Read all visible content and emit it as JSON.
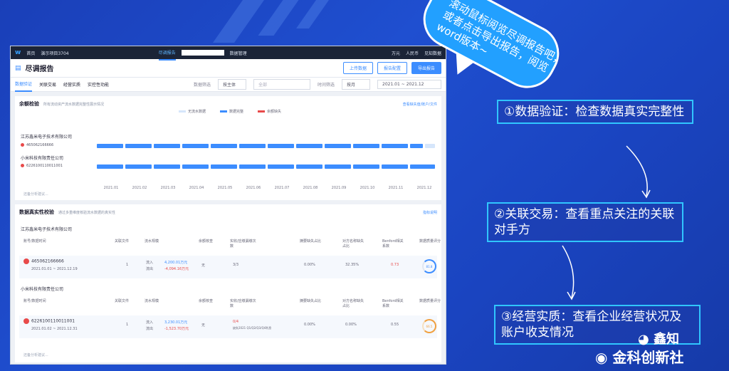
{
  "app": {
    "nav_home": "首页",
    "nav_project": "演示项目3704",
    "tab_report": "尽调报告",
    "tab_data": "数据管理",
    "unit": "万元",
    "currency": "人民币",
    "user": "见知数据"
  },
  "title": {
    "page": "尽调报告",
    "btn_upload": "上传数据",
    "btn_config": "报告配置",
    "btn_export": "导出报告"
  },
  "tabs": [
    "数据验证",
    "关联交易",
    "经营实质",
    "实控性功能"
  ],
  "filters": {
    "filter1_label": "数据筛选",
    "filter1_value": "按主体",
    "filter1_placeholder": "全部",
    "time_label": "时间筛选",
    "time_unit": "按月",
    "date_from": "2021.01",
    "date_sep": "~",
    "date_to": "2021.12"
  },
  "balance": {
    "title": "余额检验",
    "subtitle": "所有流动资产流水数据完整性展示情况",
    "link": "查看缺失值/账户/文件",
    "legend": [
      "无流水数据",
      "数据完整",
      "余额缺失"
    ],
    "company1": "江苏鑫米电子技术有限公司",
    "account1": "465062166666",
    "company2": "小米科技有限责任公司",
    "account2": "6226100110011001",
    "months": [
      "2021.01",
      "2021.02",
      "2021.03",
      "2021.04",
      "2021.05",
      "2021.06",
      "2021.07",
      "2021.08",
      "2021.09",
      "2021.10",
      "2021.11",
      "2021.12"
    ],
    "note": "还备分析建议..."
  },
  "auth": {
    "title": "数据真实性校验",
    "subtitle": "通过多重维度核验流水数据的真实性",
    "link": "指标说明",
    "company1": "江苏鑫米电子技术有限公司",
    "company2": "小米科技有限责任公司",
    "headers": [
      "账号/数据时间",
      "关联文件",
      "流水规模",
      "余额核查",
      "实收/应缴漏缴次数",
      "摘要缺失占比",
      "对方名称缺失占比",
      "Benford相关系数",
      "数据质量评分"
    ],
    "row1": {
      "account": "465062166666",
      "period": "2021.01.01 ~ 2021.12.19",
      "files": "1",
      "in_label": "流入",
      "out_label": "流出",
      "in": "4,200.01万元",
      "out": "-4,094.16万元",
      "balance": "无",
      "missing": "3/3",
      "ratio1": "0.00%",
      "ratio2": "32.35%",
      "benford": "0.73",
      "score": "81.8"
    },
    "row2": {
      "account": "6226100110011001",
      "period": "2021.01.02 ~ 2021.12.31",
      "files": "1",
      "in_label": "流入",
      "out_label": "流出",
      "in": "3,230.01万元",
      "out": "-1,523.70万元",
      "balance": "无",
      "missing": "0/4",
      "missing_note": "缺失2021 Q1/Q2/Q3/Q4利息",
      "ratio1": "0.00%",
      "ratio2": "0.00%",
      "benford": "0.55",
      "score": "66.5"
    },
    "note": "还备分析建议..."
  },
  "bubble": "滚动鼠标阅览尽调报告吧，或者点击导出报告，阅览word版本~",
  "callouts": [
    "①数据验证：检查数据真实完整性",
    "②关联交易：查看重点关注的关联对手方",
    "③经营实质：查看企业经营状况及账户收支情况"
  ],
  "watermark": {
    "line1": "鑫知",
    "line2": "金科创新社"
  },
  "colors": {
    "accent": "#3c8dff",
    "background": "#1f4fd0",
    "callout_border": "#30c6ff"
  }
}
